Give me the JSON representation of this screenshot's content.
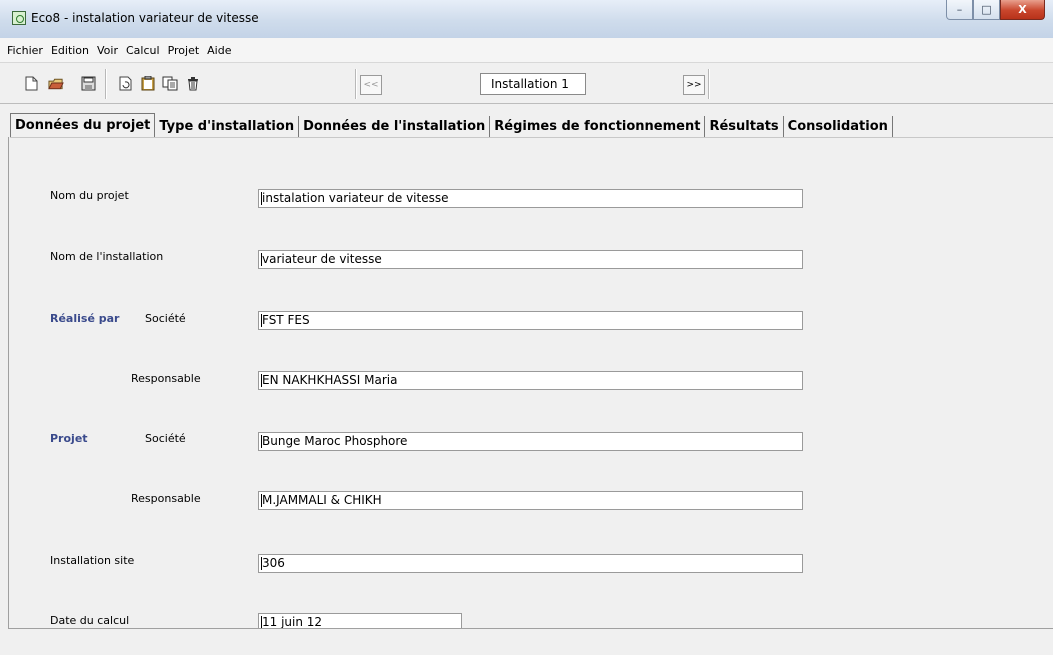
{
  "window": {
    "title": "Eco8 - instalation variateur de vitesse",
    "controls": {
      "minimize": "–",
      "maximize": "□",
      "close": "X"
    }
  },
  "menu": [
    "Fichier",
    "Edition",
    "Voir",
    "Calcul",
    "Projet",
    "Aide"
  ],
  "toolbar": {
    "icons": [
      "new-file-icon",
      "open-folder-icon",
      "save-icon",
      "refresh-document-icon",
      "clipboard-icon",
      "copy-icon",
      "delete-icon"
    ],
    "prev_label": "<<",
    "next_label": ">>",
    "installation": "Installation 1"
  },
  "tabs": [
    "Données du projet",
    "Type d'installation",
    "Données de l'installation",
    "Régimes de fonctionnement",
    "Résultats",
    "Consolidation"
  ],
  "form": {
    "nom_projet_label": "Nom du projet",
    "nom_projet": "instalation variateur de vitesse",
    "nom_installation_label": "Nom de l'installation",
    "nom_installation": "variateur de vitesse",
    "realise_par_label": "Réalisé par",
    "societe_label": "Société",
    "realise_societe": "FST FES",
    "responsable_label": "Responsable",
    "realise_responsable": "EN NAKHKHASSI Maria",
    "projet_label": "Projet",
    "projet_societe": "Bunge Maroc Phosphore",
    "projet_responsable": "M.JAMMALI & CHIKH",
    "installation_site_label": "Installation site",
    "installation_site": "306",
    "date_calcul_label": "Date du calcul",
    "date_calcul": "11 juin 12"
  }
}
